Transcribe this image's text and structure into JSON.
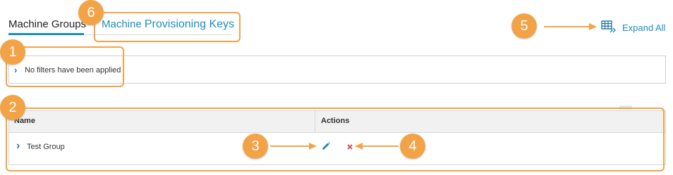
{
  "tabs": [
    {
      "label": "Machine Groups",
      "active": true
    },
    {
      "label_small": "Machine",
      "label_big": "Provisioning Keys",
      "active": false
    }
  ],
  "toolbar": {
    "expand_all_label": "Expand All",
    "icon": "expand-table-icon"
  },
  "filter": {
    "text": "No filters have been applied",
    "icon": "chevron-right-icon"
  },
  "table": {
    "columns": [
      "Name",
      "Actions"
    ],
    "rows": [
      {
        "name": "Test Group",
        "actions": [
          "edit-icon",
          "delete-icon"
        ]
      }
    ]
  },
  "callouts": [
    "1",
    "2",
    "3",
    "4",
    "5",
    "6"
  ],
  "colors": {
    "accent": "#1a8fc1",
    "callout": "#f3a347",
    "delete": "#d9534f"
  }
}
